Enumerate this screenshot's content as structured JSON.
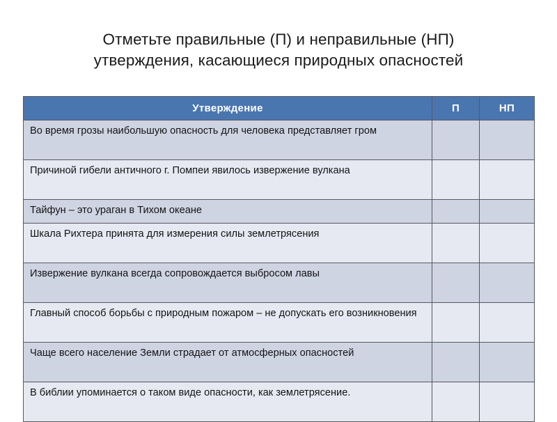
{
  "slide": {
    "background_color": "#ffffff",
    "title_lines": [
      "Отметьте правильные (П) и неправильные (НП)",
      "утверждения, касающиеся природных опасностей"
    ]
  },
  "colors": {
    "header_blue": "#4a76b0",
    "header_text": "#ffffff",
    "row_dark": "#ced4e2",
    "row_light": "#e6e9f2",
    "border": "#55585e",
    "body_text": "#141414"
  },
  "table": {
    "columns": [
      {
        "key": "statement",
        "label": "Утверждение",
        "align": "center"
      },
      {
        "key": "correct",
        "label": "П",
        "align": "center"
      },
      {
        "key": "incorrect",
        "label": "НП",
        "align": "center"
      }
    ],
    "rows": [
      {
        "index": 1,
        "statement": "Во время грозы наибольшую опасность для человека представляет гром",
        "correct": "",
        "incorrect": "",
        "lines": 2
      },
      {
        "index": 2,
        "statement": "Причиной гибели античного г. Помпеи явилось извержение вулкана",
        "correct": "",
        "incorrect": "",
        "lines": 2
      },
      {
        "index": 3,
        "statement": "Тайфун – это ураган в Тихом океане",
        "correct": "",
        "incorrect": "",
        "lines": 1
      },
      {
        "index": 4,
        "statement": "Шкала Рихтера принята для измерения силы землетрясения",
        "correct": "",
        "incorrect": "",
        "lines": 2
      },
      {
        "index": 5,
        "statement": "Извержение вулкана всегда сопровождается выбросом лавы",
        "correct": "",
        "incorrect": "",
        "lines": 2
      },
      {
        "index": 6,
        "statement": "Главный способ борьбы с природным пожаром – не допускать его возникновения",
        "correct": "",
        "incorrect": "",
        "lines": 2
      },
      {
        "index": 7,
        "statement": "Чаще всего население Земли страдает от атмосферных опасностей",
        "correct": "",
        "incorrect": "",
        "lines": 2
      },
      {
        "index": 8,
        "statement": "В библии упоминается о таком виде опасности, как землетрясение.",
        "correct": "",
        "incorrect": "",
        "lines": 2
      }
    ]
  }
}
